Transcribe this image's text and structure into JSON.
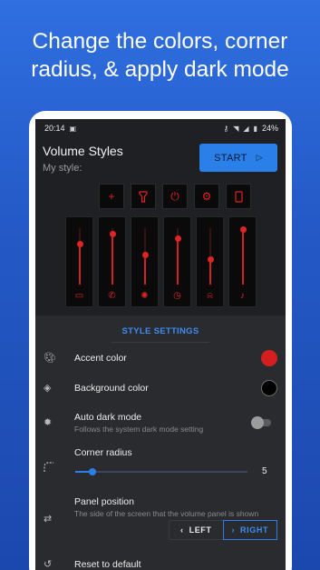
{
  "headline": "Change the colors, corner\nradius, & apply dark mode",
  "status_bar": {
    "time": "20:14",
    "battery": "24%",
    "icons": [
      "gallery-icon",
      "key-icon",
      "wifi-icon",
      "signal-icon",
      "battery-icon"
    ]
  },
  "app": {
    "title": "Volume Styles",
    "subtitle": "My style:",
    "start_label": "START"
  },
  "preview": {
    "buttons": [
      "add-icon",
      "flashlight-icon",
      "power-icon",
      "settings-icon",
      "screen-rotate-icon"
    ],
    "sliders": [
      {
        "icon": "chat-icon",
        "level": 0.72
      },
      {
        "icon": "phone-icon",
        "level": 0.9
      },
      {
        "icon": "gear-icon",
        "level": 0.52
      },
      {
        "icon": "alarm-icon",
        "level": 0.82
      },
      {
        "icon": "bell-icon",
        "level": 0.45
      },
      {
        "icon": "music-icon",
        "level": 0.97
      }
    ],
    "accent_color": "#e02424"
  },
  "settings": {
    "section_title": "STYLE SETTINGS",
    "accent": {
      "label": "Accent color",
      "color": "#d31f1f"
    },
    "background": {
      "label": "Background color",
      "color": "#000000"
    },
    "auto_dark": {
      "label": "Auto dark mode",
      "description": "Follows the system dark mode setting",
      "enabled": false
    },
    "corner_radius": {
      "label": "Corner radius",
      "value": "5",
      "fraction": 0.1
    },
    "panel_position": {
      "label": "Panel position",
      "description": "The side of the screen that the volume panel is shown",
      "left_label": "LEFT",
      "right_label": "RIGHT",
      "selected": "RIGHT"
    },
    "reset": {
      "label": "Reset to default"
    }
  },
  "colors": {
    "brand_blue": "#2b7fe8",
    "panel_bg": "#2a2b2e",
    "screen_bg": "#1f2023"
  }
}
